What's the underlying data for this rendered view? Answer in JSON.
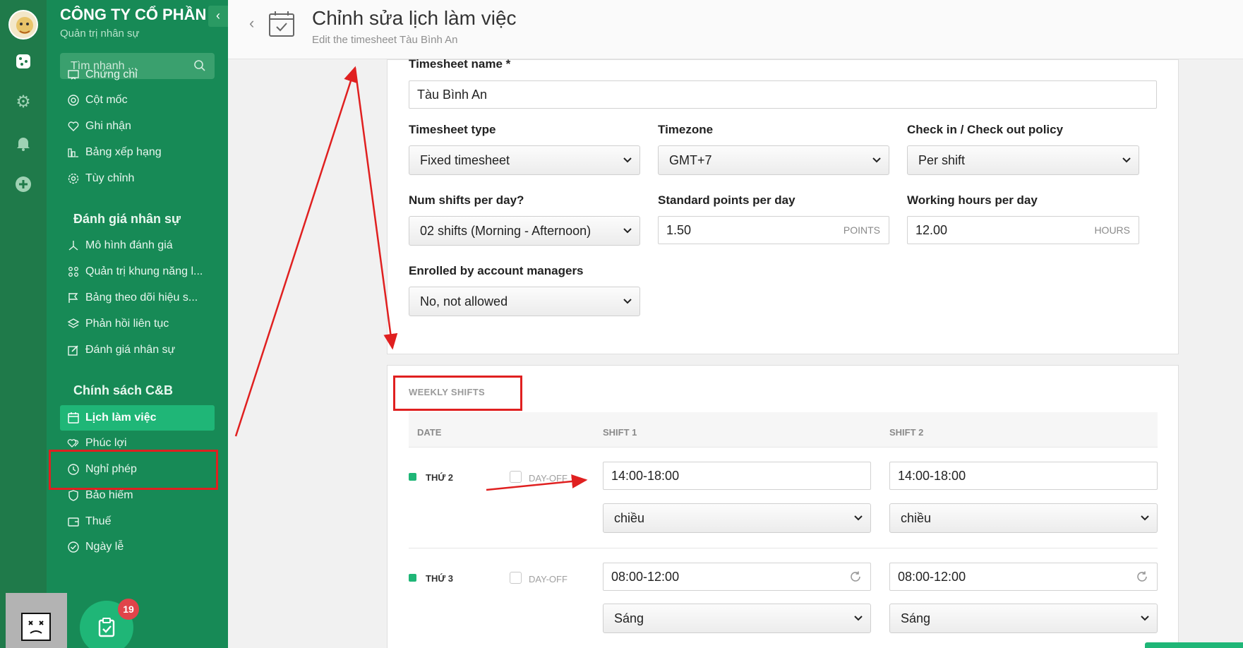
{
  "sidebar": {
    "company": "CÔNG TY CỔ PHẦN ...",
    "company_sub": "Quản trị nhân sự",
    "search_placeholder": "Tìm nhanh ...",
    "items_top": [
      "Chứng chỉ",
      "Cột mốc",
      "Ghi nhận",
      "Bảng xếp hạng",
      "Tùy chỉnh"
    ],
    "section_eval": "Đánh giá nhân sự",
    "items_eval": [
      "Mô hình đánh giá",
      "Quản trị khung năng l...",
      "Bảng theo dõi hiệu s...",
      "Phản hồi liên tục",
      "Đánh giá nhân sự"
    ],
    "section_cb": "Chính sách C&B",
    "items_cb": [
      "Lịch làm việc",
      "Phúc lợi",
      "Nghỉ phép",
      "Bảo hiểm",
      "Thuế",
      "Ngày lễ"
    ],
    "badge": "19"
  },
  "header": {
    "title": "Chỉnh sửa lịch làm việc",
    "subtitle": "Edit the timesheet Tàu Bình An"
  },
  "form": {
    "name_label": "Timesheet name *",
    "name_value": "Tàu Bình An",
    "type_label": "Timesheet type",
    "type_value": "Fixed timesheet",
    "timezone_label": "Timezone",
    "timezone_value": "GMT+7",
    "policy_label": "Check in / Check out policy",
    "policy_value": "Per shift",
    "shifts_label": "Num shifts per day?",
    "shifts_value": "02 shifts (Morning - Afternoon)",
    "points_label": "Standard points per day",
    "points_value": "1.50",
    "points_unit": "POINTS",
    "hours_label": "Working hours per day",
    "hours_value": "12.00",
    "hours_unit": "HOURS",
    "enrolled_label": "Enrolled by account managers",
    "enrolled_value": "No, not allowed"
  },
  "weekly": {
    "title": "WEEKLY SHIFTS",
    "col_date": "DATE",
    "col_shift1": "SHIFT 1",
    "col_shift2": "SHIFT 2",
    "dayoff_label": "DAY-OFF",
    "rows": [
      {
        "day": "THỨ 2",
        "s1_time": "14:00-18:00",
        "s1_name": "chiều",
        "s2_time": "14:00-18:00",
        "s2_name": "chiều"
      },
      {
        "day": "THỨ 3",
        "s1_time": "08:00-12:00",
        "s1_name": "Sáng",
        "s2_time": "08:00-12:00",
        "s2_name": "Sáng"
      }
    ]
  },
  "colors": {
    "sidebar": "#178a56",
    "rail": "#1f7a4a",
    "accent": "#1fb677",
    "annotation": "#e02020"
  }
}
